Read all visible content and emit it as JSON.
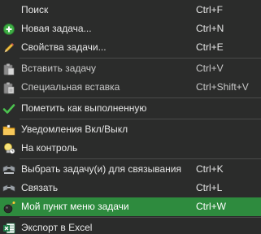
{
  "menu": {
    "items": [
      {
        "label": "Поиск",
        "shortcut": "Ctrl+F",
        "icon": "none"
      },
      {
        "label": "Новая задача...",
        "shortcut": "Ctrl+N",
        "icon": "add-circle-icon"
      },
      {
        "label": "Свойства задачи...",
        "shortcut": "Ctrl+E",
        "icon": "pencil-icon"
      },
      {
        "label": "Вставить задачу",
        "shortcut": "Ctrl+V",
        "icon": "paste-icon"
      },
      {
        "label": "Специальная вставка",
        "shortcut": "Ctrl+Shift+V",
        "icon": "paste-special-icon"
      },
      {
        "label": "Пометить как выполненную",
        "shortcut": "",
        "icon": "checkmark-icon"
      },
      {
        "label": "Уведомления Вкл/Выкл",
        "shortcut": "",
        "icon": "folder-notification-icon"
      },
      {
        "label": "На контроль",
        "shortcut": "",
        "icon": "lightbulb-icon"
      },
      {
        "label": "Выбрать задачу(и) для связывания",
        "shortcut": "Ctrl+K",
        "icon": "link-select-icon"
      },
      {
        "label": "Связать",
        "shortcut": "Ctrl+L",
        "icon": "link-icon"
      },
      {
        "label": "Мой пункт меню задачи",
        "shortcut": "Ctrl+W",
        "icon": "bomb-icon"
      },
      {
        "label": "Экспорт в Excel",
        "shortcut": "",
        "icon": "excel-icon"
      }
    ]
  },
  "colors": {
    "background": "#2b2c2b",
    "highlight": "#2e8b3e",
    "text": "#e6e6e6"
  }
}
